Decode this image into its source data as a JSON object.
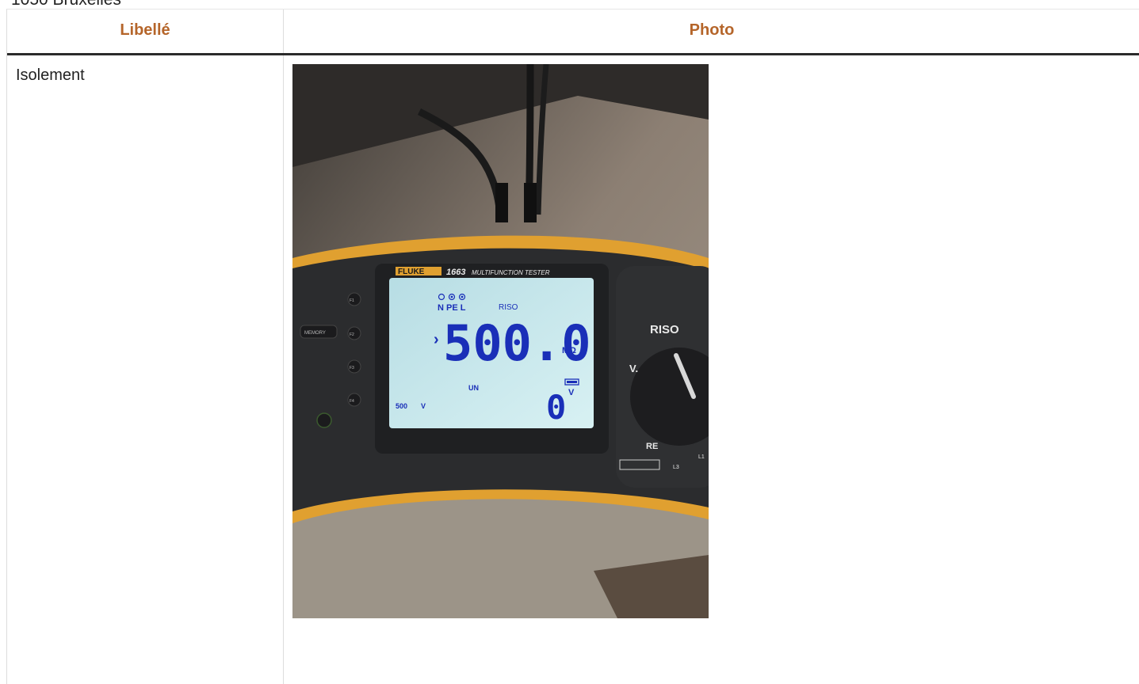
{
  "address": {
    "city_line": "1050 Bruxelles"
  },
  "table": {
    "headers": {
      "label": "Libellé",
      "photo": "Photo"
    },
    "rows": [
      {
        "label": "Isolement"
      }
    ]
  },
  "photo": {
    "device_brand": "FLUKE",
    "device_model": "1663",
    "device_title": "MULTIFUNCTION TESTER",
    "terminals": "N PE L",
    "mode_label": "RISO",
    "main_reading": "500.0",
    "main_unit": "MΩ",
    "nominal_label": "UN",
    "test_voltage": "500",
    "test_voltage_unit": "V",
    "secondary_reading": "0",
    "secondary_unit": "V",
    "soft_keys": [
      "F1",
      "F2",
      "F3",
      "F4"
    ],
    "memory_button": "MEMORY",
    "dial_riso": "RISO",
    "dial_v": "V.",
    "dial_re": "RE",
    "dial_l1": "L1",
    "dial_l3": "L3",
    "colors": {
      "lcd": "#c9e8ee",
      "lcd_digits": "#1a2fb8",
      "body": "#2b2c2e",
      "bezel": "#e0a030"
    }
  }
}
